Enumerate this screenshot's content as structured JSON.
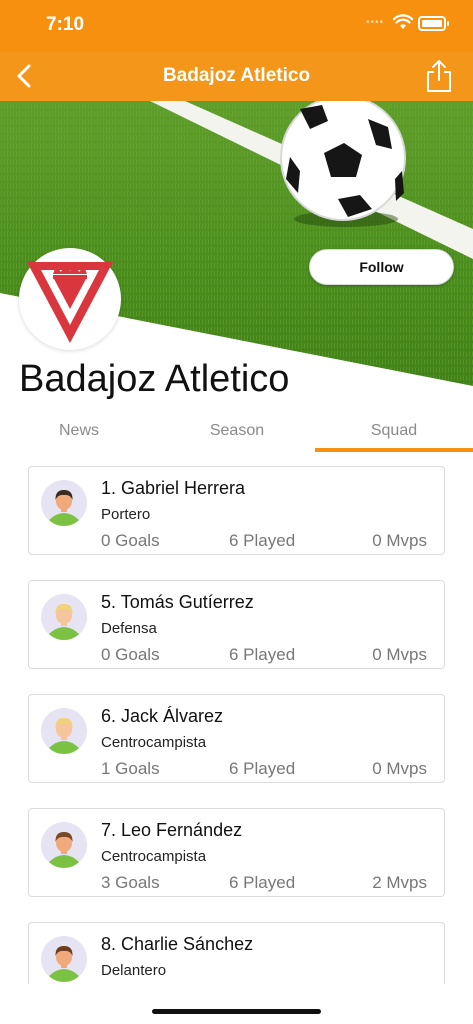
{
  "status_bar": {
    "time": "7:10"
  },
  "nav": {
    "title": "Badajoz Atletico"
  },
  "team": {
    "name": "Badajoz Atletico",
    "follow_label": "Follow"
  },
  "tabs": [
    {
      "label": "News",
      "active": false
    },
    {
      "label": "Season",
      "active": false
    },
    {
      "label": "Squad",
      "active": true
    }
  ],
  "players": [
    {
      "name": "1. Gabriel Herrera",
      "position": "Portero",
      "goals": "0 Goals",
      "played": "6 Played",
      "mvps": "0 Mvps",
      "hair_color": "#3a2a1f"
    },
    {
      "name": "5. Tomás Gutíerrez",
      "position": "Defensa",
      "goals": "0 Goals",
      "played": "6 Played",
      "mvps": "0 Mvps",
      "hair_color": "#f2d37a"
    },
    {
      "name": "6. Jack Álvarez",
      "position": "Centrocampista",
      "goals": "1 Goals",
      "played": "6 Played",
      "mvps": "0 Mvps",
      "hair_color": "#f2d37a"
    },
    {
      "name": "7. Leo Fernández",
      "position": "Centrocampista",
      "goals": "3 Goals",
      "played": "6 Played",
      "mvps": "2 Mvps",
      "hair_color": "#7a4a24"
    },
    {
      "name": "8. Charlie Sánchez",
      "position": "Delantero",
      "goals": "",
      "played": "",
      "mvps": "",
      "hair_color": "#6b3d1e"
    }
  ],
  "colors": {
    "accent": "#f7900f",
    "nav": "#f39619",
    "logo_red": "#d9363e",
    "jersey_green": "#7cc242"
  },
  "icons": [
    "back-icon",
    "share-icon",
    "wifi-icon",
    "battery-icon",
    "soccer-ball-icon",
    "crown-shield-icon",
    "player-avatar-icon"
  ]
}
